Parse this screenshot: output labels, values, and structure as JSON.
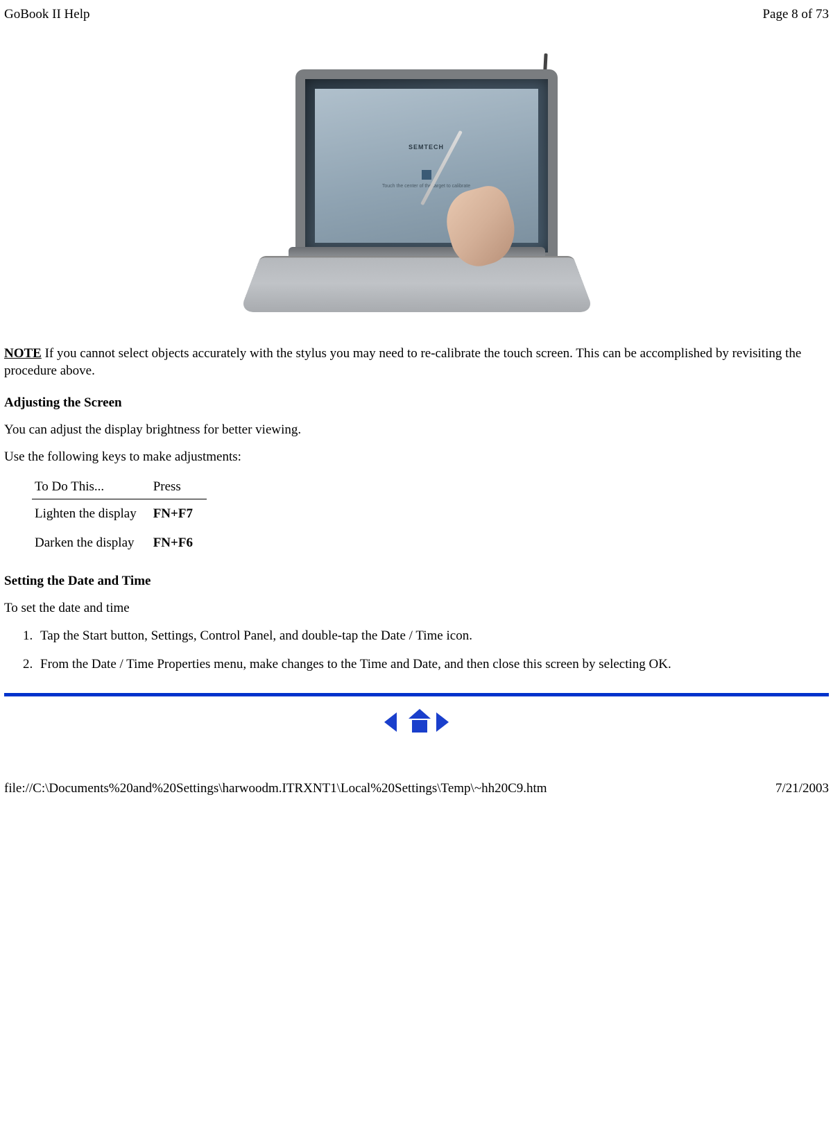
{
  "header": {
    "title": "GoBook II Help",
    "page_indicator": "Page 8 of 73"
  },
  "image": {
    "screen_logo": "SEMTECH",
    "screen_text": "Touch the center of the target to calibrate"
  },
  "note": {
    "label": "NOTE",
    "text": "  If you cannot select objects accurately with the stylus you may need to re-calibrate the touch screen.  This can be accomplished by revisiting the procedure above."
  },
  "adjust": {
    "heading": "Adjusting the Screen",
    "p1": "You can adjust the display brightness for better viewing.",
    "p2": "Use the following keys to make adjustments:"
  },
  "table": {
    "h1": "To Do This...",
    "h2": "Press",
    "r1c1": "Lighten  the display",
    "r1c2": "FN+F7",
    "r2c1": "Darken the display",
    "r2c2": "FN+F6"
  },
  "datetime": {
    "heading": "Setting the Date and Time",
    "intro": "To set the date and time",
    "step1": "Tap the Start button,  Settings, Control Panel, and double-tap the Date / Time icon.",
    "step2": "From the Date / Time Properties menu,  make changes to the Time and Date, and then close this screen by selecting OK."
  },
  "footer": {
    "path": "file://C:\\Documents%20and%20Settings\\harwoodm.ITRXNT1\\Local%20Settings\\Temp\\~hh20C9.htm",
    "date": "7/21/2003"
  }
}
